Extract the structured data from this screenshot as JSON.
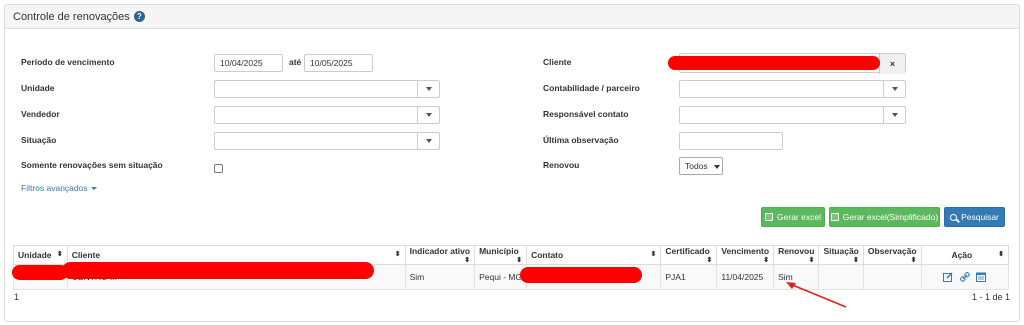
{
  "panel": {
    "title": "Controle de renovações"
  },
  "filters": {
    "periodo_label": "Período de vencimento",
    "periodo_de": "10/04/2025",
    "ate_label": "até",
    "periodo_ate": "10/05/2025",
    "unidade_label": "Unidade",
    "vendedor_label": "Vendedor",
    "situacao_label": "Situação",
    "somente_label": "Somente renovações sem situação",
    "avancados_label": "Filtros avançados",
    "cliente_label": "Cliente",
    "cliente_clear": "×",
    "contabilidade_label": "Contabilidade / parceiro",
    "responsavel_label": "Responsável contato",
    "ultima_obs_label": "Última observação",
    "renovou_label": "Renovou",
    "renovou_value": "Todos"
  },
  "buttons": {
    "gerar_excel": "Gerar excel",
    "gerar_excel_simpl": "Gerar excel(Simplificado)",
    "pesquisar": "Pesquisar"
  },
  "table": {
    "headers": [
      "Unidade",
      "Cliente",
      "Indicador ativo",
      "Município",
      "Contato",
      "Certificado",
      "Vencimento",
      "Renovou",
      "Situação",
      "Observação",
      "Ação"
    ],
    "rows": [
      {
        "unidade": "",
        "cliente": "CENTRO ...",
        "indicador": "Sim",
        "municipio": "Pequi - MG",
        "contato": "",
        "certificado": "PJA1",
        "vencimento": "11/04/2025",
        "renovou": "Sim",
        "situacao": "",
        "observacao": ""
      }
    ]
  },
  "pager": {
    "page": "1",
    "range": "1 - 1 de 1"
  },
  "icons": [
    "help-icon",
    "edit-icon",
    "link-icon",
    "calendar-icon",
    "excel-icon",
    "search-icon"
  ],
  "colors": {
    "accent": "#337ab7",
    "success": "#5cb85c",
    "redaction": "#ff0000"
  }
}
